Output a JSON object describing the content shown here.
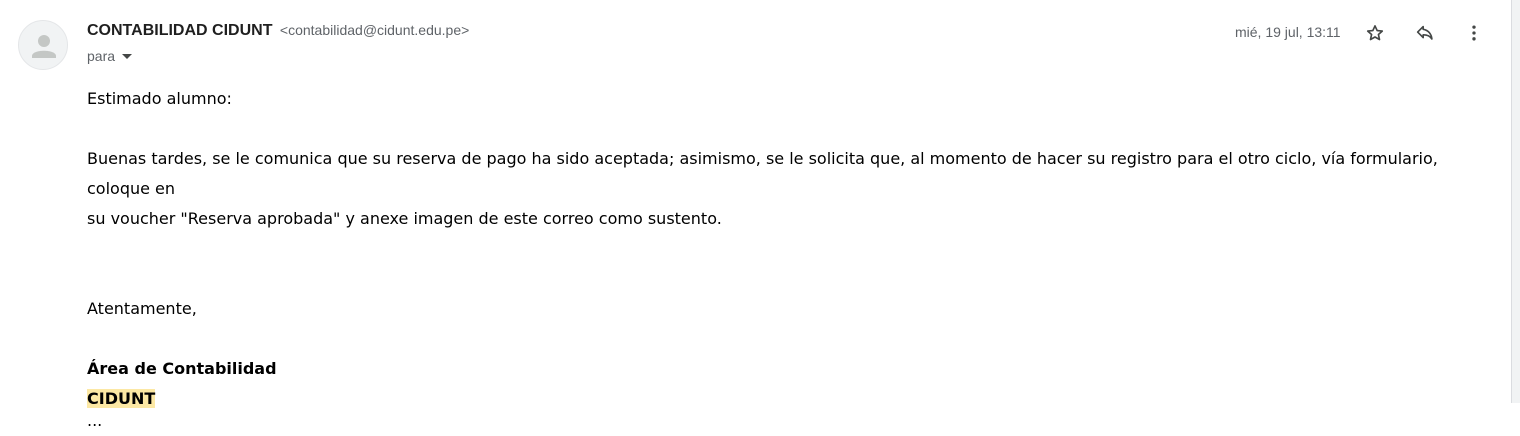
{
  "email": {
    "sender_name": "CONTABILIDAD CIDUNT",
    "sender_email": "<contabilidad@cidunt.edu.pe>",
    "to_label": "para",
    "date": "mié, 19 jul, 13:11"
  },
  "actions": {
    "star_icon": "star-icon",
    "reply_icon": "reply-icon",
    "more_icon": "more-vert-icon"
  },
  "body": {
    "greeting": "Estimado alumno:",
    "paragraph_line1": "Buenas tardes, se le comunica que su reserva de pago ha sido aceptada; asimismo, se le solicita que, al momento de hacer su registro para el otro ciclo, vía formulario, coloque en",
    "paragraph_line2": "su voucher \"Reserva aprobada\" y anexe imagen de este correo como sustento.",
    "closing": "Atentamente,",
    "signature_area": "Área de Contabilidad",
    "signature_org": "CIDUNT",
    "trimmed": "..."
  },
  "colors": {
    "highlight": "#fce8a4",
    "secondary_text": "#5f6368"
  }
}
